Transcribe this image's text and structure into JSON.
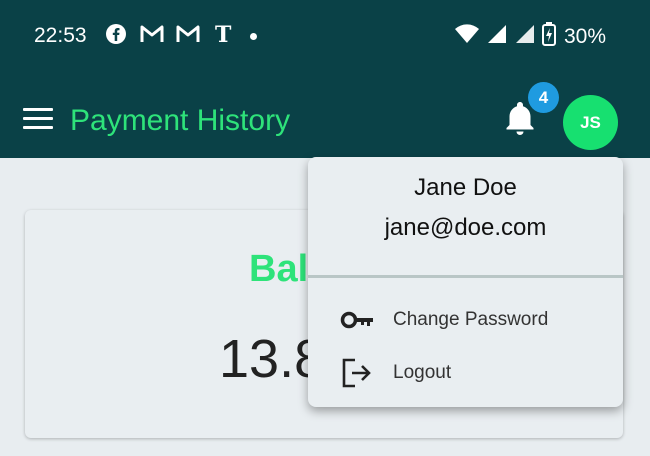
{
  "status_bar": {
    "time": "22:53",
    "battery": "30%",
    "notification_icons": [
      "facebook-icon",
      "gmail-icon",
      "gmail-icon",
      "nytimes-icon"
    ]
  },
  "app_bar": {
    "title": "Payment History",
    "notification_count": "4",
    "avatar_initials": "JS"
  },
  "card": {
    "title_visible": "Bal",
    "value_visible": "13.8"
  },
  "user_menu": {
    "name": "Jane Doe",
    "email": "jane@doe.com",
    "items": [
      {
        "label": "Change Password",
        "icon": "key-icon"
      },
      {
        "label": "Logout",
        "icon": "logout-icon"
      }
    ]
  },
  "colors": {
    "header_bg": "#0a4147",
    "accent_green": "#2ee37a",
    "avatar_bg": "#17e070",
    "badge_bg": "#1f9be0",
    "surface": "#e9eef1"
  }
}
